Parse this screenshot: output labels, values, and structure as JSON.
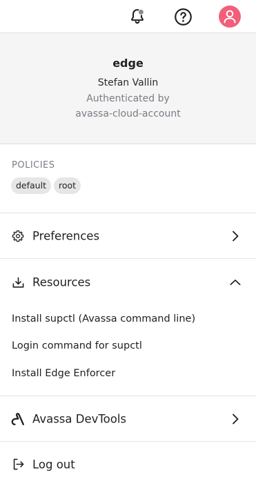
{
  "topbar": {
    "icons": [
      "bell-icon",
      "help-icon",
      "user-avatar-icon"
    ],
    "notification_dot_color": "#8a8a8a",
    "avatar_color": "#f25f7a"
  },
  "profile": {
    "site": "edge",
    "user": "Stefan Vallin",
    "authenticated_by_label": "Authenticated by",
    "account": "avassa-cloud-account"
  },
  "policies": {
    "heading": "POLICIES",
    "items": [
      "default",
      "root"
    ]
  },
  "menu": {
    "preferences": {
      "label": "Preferences",
      "icon": "gear-icon"
    },
    "resources": {
      "label": "Resources",
      "icon": "download-icon",
      "expanded": true,
      "items": [
        "Install supctl (Avassa command line)",
        "Login command for supctl",
        "Install Edge Enforcer"
      ]
    },
    "devtools": {
      "label": "Avassa DevTools",
      "icon": "avassa-logo-icon"
    },
    "logout": {
      "label": "Log out",
      "icon": "logout-icon"
    }
  }
}
